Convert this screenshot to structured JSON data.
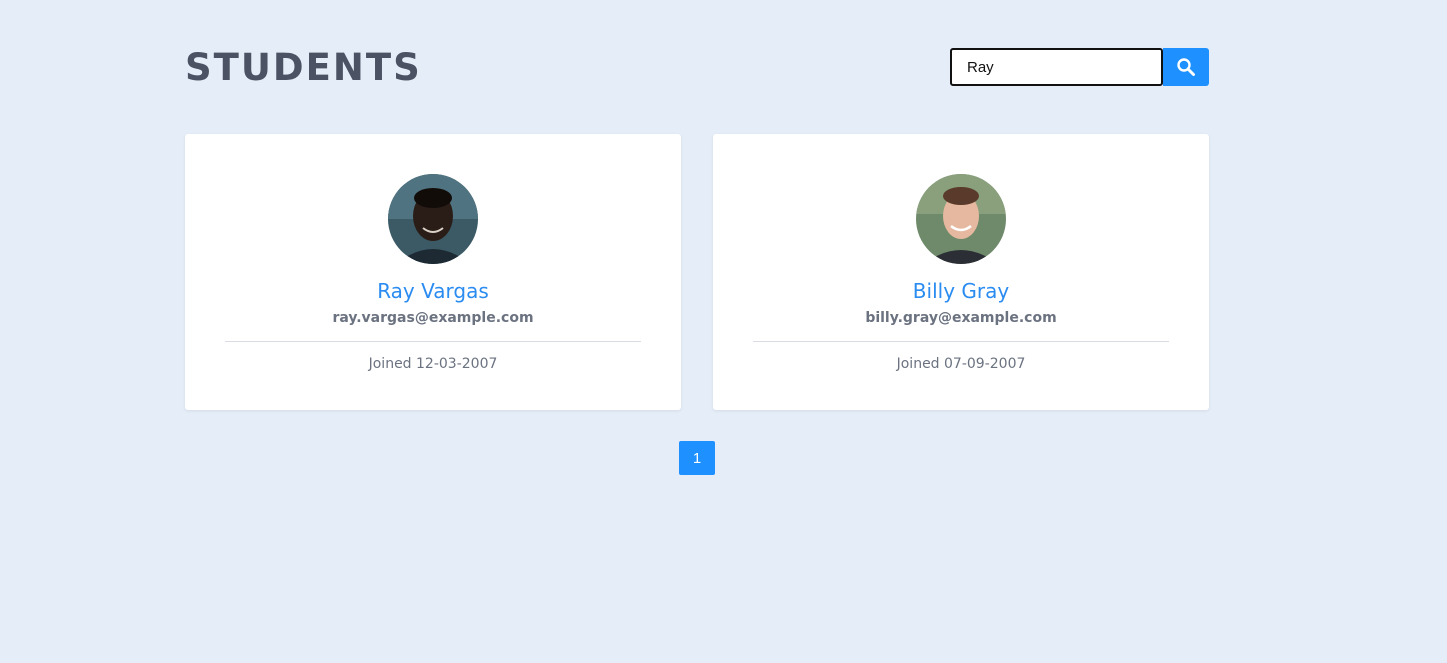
{
  "header": {
    "title": "STUDENTS"
  },
  "search": {
    "value": "Ray",
    "icon": "search-icon"
  },
  "students": [
    {
      "name": "Ray Vargas",
      "email": "ray.vargas@example.com",
      "joined": "Joined 12-03-2007"
    },
    {
      "name": "Billy Gray",
      "email": "billy.gray@example.com",
      "joined": "Joined 07-09-2007"
    }
  ],
  "pagination": {
    "pages": [
      "1"
    ],
    "current": "1"
  },
  "colors": {
    "background": "#e5edf9",
    "accent": "#1e90ff",
    "name": "#2a8cf0",
    "title": "#4a5263"
  }
}
